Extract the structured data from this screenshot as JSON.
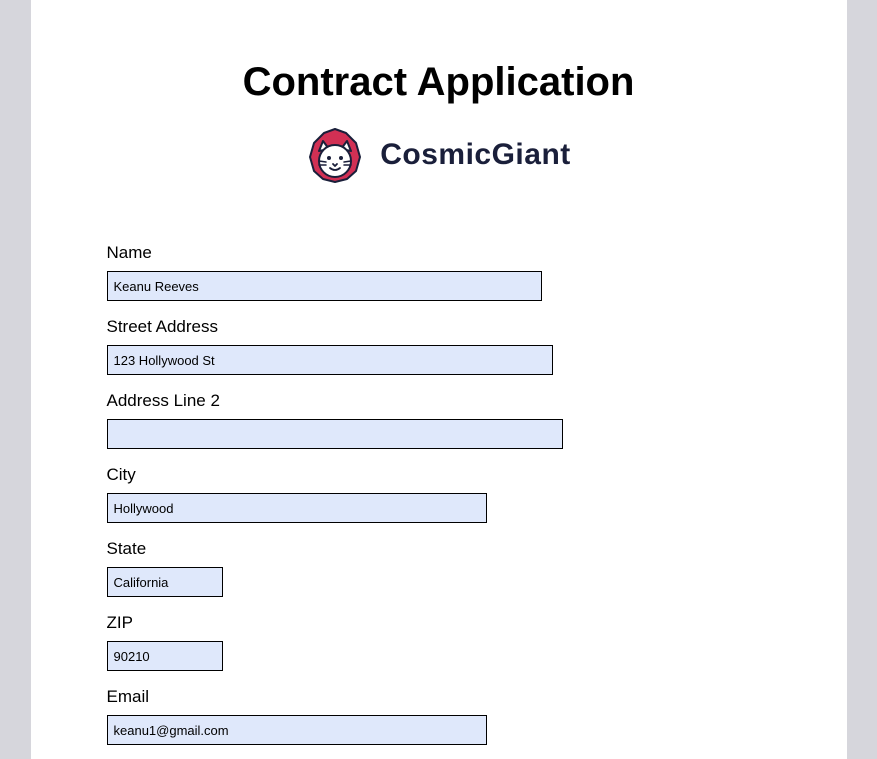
{
  "title": "Contract Application",
  "brand": {
    "name": "CosmicGiant"
  },
  "form": {
    "name": {
      "label": "Name",
      "value": "Keanu Reeves"
    },
    "street": {
      "label": "Street Address",
      "value": "123 Hollywood St"
    },
    "line2": {
      "label": "Address Line 2",
      "value": ""
    },
    "city": {
      "label": "City",
      "value": "Hollywood"
    },
    "state": {
      "label": "State",
      "value": "California"
    },
    "zip": {
      "label": "ZIP",
      "value": "90210"
    },
    "email": {
      "label": "Email",
      "value": "keanu1@gmail.com"
    }
  }
}
